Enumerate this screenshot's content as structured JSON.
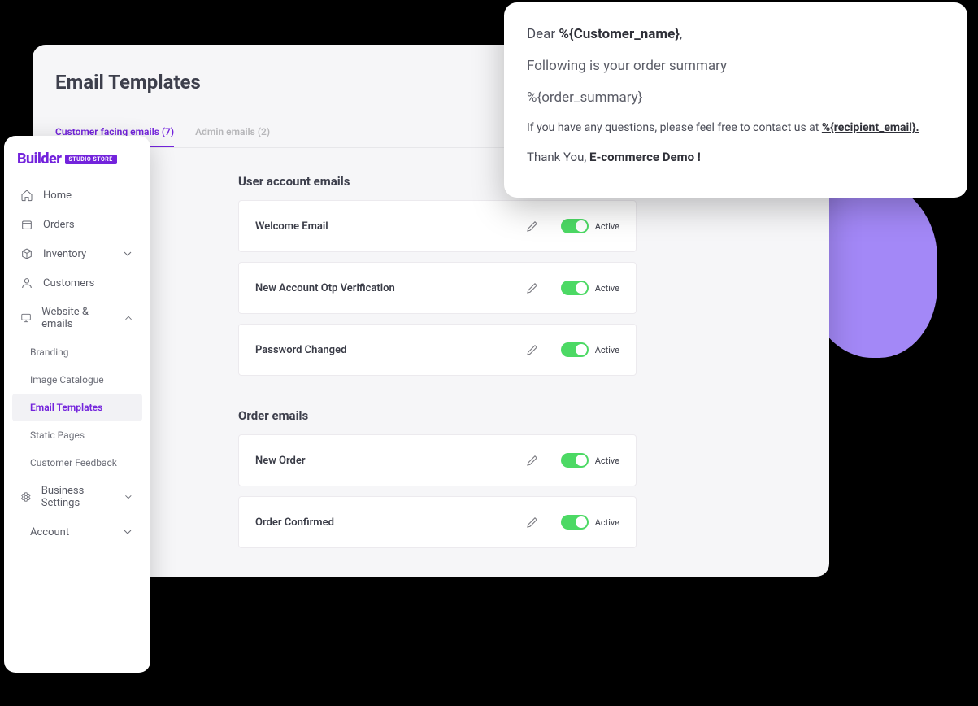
{
  "page": {
    "title": "Email Templates"
  },
  "tabs": {
    "customer": "Customer facing emails (7)",
    "admin": "Admin emails (2)"
  },
  "section1": {
    "title": "User account emails",
    "items": [
      {
        "label": "Welcome Email",
        "status": "Active"
      },
      {
        "label": "New Account Otp Verification",
        "status": "Active"
      },
      {
        "label": "Password Changed",
        "status": "Active"
      }
    ]
  },
  "section2": {
    "title": "Order emails",
    "items": [
      {
        "label": "New Order",
        "status": "Active"
      },
      {
        "label": "Order Confirmed",
        "status": "Active"
      }
    ]
  },
  "sidebar": {
    "logo_word": "Builder",
    "logo_chip": "STUDIO STORE",
    "items": {
      "home": "Home",
      "orders": "Orders",
      "inventory": "Inventory",
      "customers": "Customers",
      "website": "Website & emails",
      "business": "Business Settings",
      "account": "Account"
    },
    "subitems": {
      "branding": "Branding",
      "catalogue": "Image Catalogue",
      "email_templates": "Email Templates",
      "static_pages": "Static Pages",
      "feedback": "Customer Feedback"
    }
  },
  "preview": {
    "greet_prefix": "Dear ",
    "greet_token": "%{Customer_name}",
    "greet_suffix": ",",
    "line2": "Following is your order summary",
    "line3": "%{order_summary}",
    "line4_prefix": "If you have any questions, please feel free to contact us at ",
    "line4_link": "%{recipient_email}.",
    "sig_prefix": "Thank You, ",
    "sig_bold": "E-commerce Demo !"
  }
}
